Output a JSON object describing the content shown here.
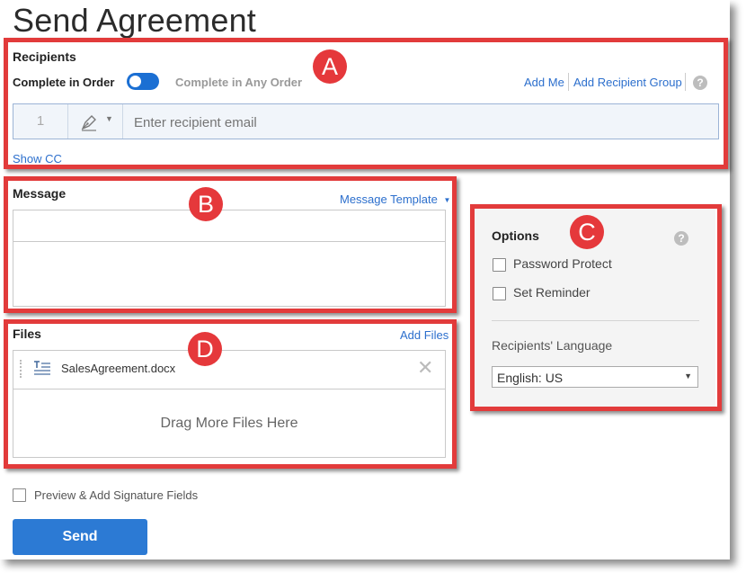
{
  "page": {
    "title": "Send Agreement"
  },
  "recipients": {
    "label": "Recipients",
    "complete_in_order": "Complete in Order",
    "complete_any_order": "Complete in Any Order",
    "add_me": "Add Me",
    "add_group": "Add Recipient Group",
    "row_number": "1",
    "email_placeholder": "Enter recipient email",
    "show_cc": "Show CC"
  },
  "message": {
    "label": "Message",
    "template_link": "Message Template"
  },
  "options": {
    "label": "Options",
    "password_protect": "Password Protect",
    "set_reminder": "Set Reminder",
    "language_label": "Recipients' Language",
    "language_value": "English: US"
  },
  "files": {
    "label": "Files",
    "add_files": "Add Files",
    "file_name": "SalesAgreement.docx",
    "drop_text": "Drag More Files Here"
  },
  "footer": {
    "preview_label": "Preview & Add Signature Fields",
    "send_label": "Send"
  },
  "callouts": {
    "a": "A",
    "b": "B",
    "c": "C",
    "d": "D"
  },
  "colors": {
    "accent": "#2c6fcd",
    "highlight": "#e23b3b",
    "toggle": "#1b6fd3"
  }
}
